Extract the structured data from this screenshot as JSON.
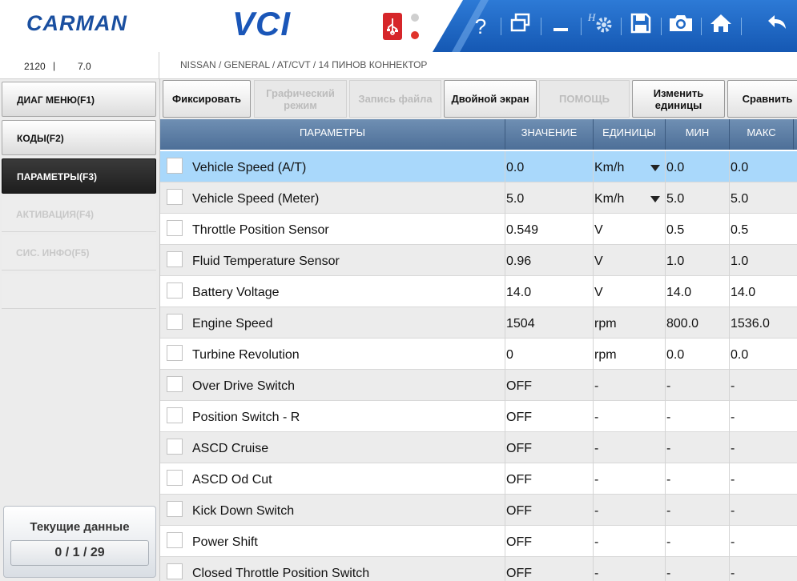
{
  "header": {
    "logo_text": "CARMAN",
    "vci_text": "VCI",
    "usb_label": "USB",
    "brand_color": "#1a56b8",
    "toolbar_color": "#1e67c4"
  },
  "info": {
    "value_a": "2120",
    "value_b": "7.0",
    "path": "NISSAN / GENERAL / AT/CVT / 14 ПИНОВ КОННЕКТОР"
  },
  "sidebar": {
    "items": [
      {
        "label": "ДИАГ МЕНЮ(F1)",
        "state": "active"
      },
      {
        "label": "КОДЫ(F2)",
        "state": "active"
      },
      {
        "label": "ПАРАМЕТРЫ(F3)",
        "state": "selected"
      },
      {
        "label": "АКТИВАЦИЯ(F4)",
        "state": "disabled"
      },
      {
        "label": "СИС. ИНФО(F5)",
        "state": "disabled"
      }
    ],
    "current_title": "Текущие данные",
    "current_counter": "0 / 1 / 29"
  },
  "toolbar": {
    "buttons": [
      {
        "label": "Фиксировать",
        "enabled": true
      },
      {
        "label": "Графический режим",
        "enabled": false
      },
      {
        "label": "Запись файла",
        "enabled": false
      },
      {
        "label": "Двойной экран",
        "enabled": true
      },
      {
        "label": "ПОМОЩЬ",
        "enabled": false
      },
      {
        "label": "Изменить единицы",
        "enabled": true
      },
      {
        "label": "Сравнить",
        "enabled": true
      }
    ]
  },
  "table": {
    "headers": [
      "ПАРАМЕТРЫ",
      "ЗНАЧЕНИЕ",
      "ЕДИНИЦЫ",
      "МИН",
      "МАКС"
    ],
    "rows": [
      {
        "name": "Vehicle Speed (A/T)",
        "value": "0.0",
        "unit": "Km/h",
        "min": "0.0",
        "max": "0.0",
        "dropdown": true,
        "selected": true
      },
      {
        "name": "Vehicle Speed (Meter)",
        "value": "5.0",
        "unit": "Km/h",
        "min": "5.0",
        "max": "5.0",
        "dropdown": true,
        "selected": false
      },
      {
        "name": "Throttle Position Sensor",
        "value": "0.549",
        "unit": "V",
        "min": "0.5",
        "max": "0.5",
        "dropdown": false,
        "selected": false
      },
      {
        "name": "Fluid Temperature Sensor",
        "value": "0.96",
        "unit": "V",
        "min": "1.0",
        "max": "1.0",
        "dropdown": false,
        "selected": false
      },
      {
        "name": "Battery Voltage",
        "value": "14.0",
        "unit": "V",
        "min": "14.0",
        "max": "14.0",
        "dropdown": false,
        "selected": false
      },
      {
        "name": "Engine Speed",
        "value": "1504",
        "unit": "rpm",
        "min": "800.0",
        "max": "1536.0",
        "dropdown": false,
        "selected": false
      },
      {
        "name": "Turbine Revolution",
        "value": "0",
        "unit": "rpm",
        "min": "0.0",
        "max": "0.0",
        "dropdown": false,
        "selected": false
      },
      {
        "name": "Over Drive Switch",
        "value": "OFF",
        "unit": "-",
        "min": "-",
        "max": "-",
        "dropdown": false,
        "selected": false
      },
      {
        "name": "Position Switch - R",
        "value": "OFF",
        "unit": "-",
        "min": "-",
        "max": "-",
        "dropdown": false,
        "selected": false
      },
      {
        "name": "ASCD Cruise",
        "value": "OFF",
        "unit": "-",
        "min": "-",
        "max": "-",
        "dropdown": false,
        "selected": false
      },
      {
        "name": "ASCD Od Cut",
        "value": "OFF",
        "unit": "-",
        "min": "-",
        "max": "-",
        "dropdown": false,
        "selected": false
      },
      {
        "name": "Kick Down Switch",
        "value": "OFF",
        "unit": "-",
        "min": "-",
        "max": "-",
        "dropdown": false,
        "selected": false
      },
      {
        "name": "Power Shift",
        "value": "OFF",
        "unit": "-",
        "min": "-",
        "max": "-",
        "dropdown": false,
        "selected": false
      },
      {
        "name": "Closed Throttle Position Switch",
        "value": "OFF",
        "unit": "-",
        "min": "-",
        "max": "-",
        "dropdown": false,
        "selected": false
      }
    ]
  }
}
